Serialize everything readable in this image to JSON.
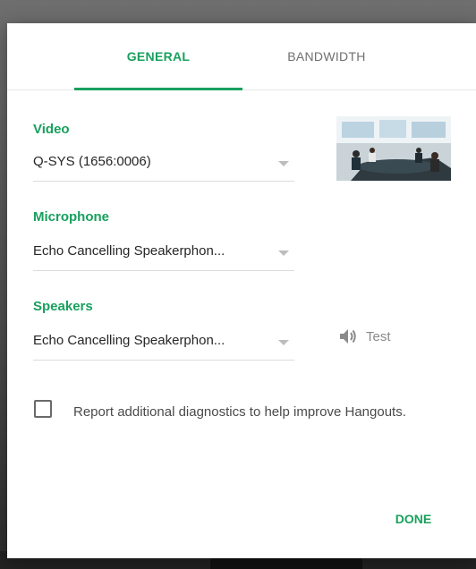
{
  "tabs": {
    "general": "GENERAL",
    "bandwidth": "BANDWIDTH",
    "selected": "GENERAL"
  },
  "video": {
    "label": "Video",
    "value": "Q-SYS (1656:0006)"
  },
  "microphone": {
    "label": "Microphone",
    "value": "Echo Cancelling Speakerphon..."
  },
  "speakers": {
    "label": "Speakers",
    "value": "Echo Cancelling Speakerphon...",
    "test_label": "Test",
    "test_icon": "speaker-icon"
  },
  "diagnostics": {
    "text": "Report additional diagnostics to help improve Hangouts.",
    "checked": false
  },
  "actions": {
    "done_label": "DONE"
  },
  "colors": {
    "accent": "#18a05e"
  }
}
